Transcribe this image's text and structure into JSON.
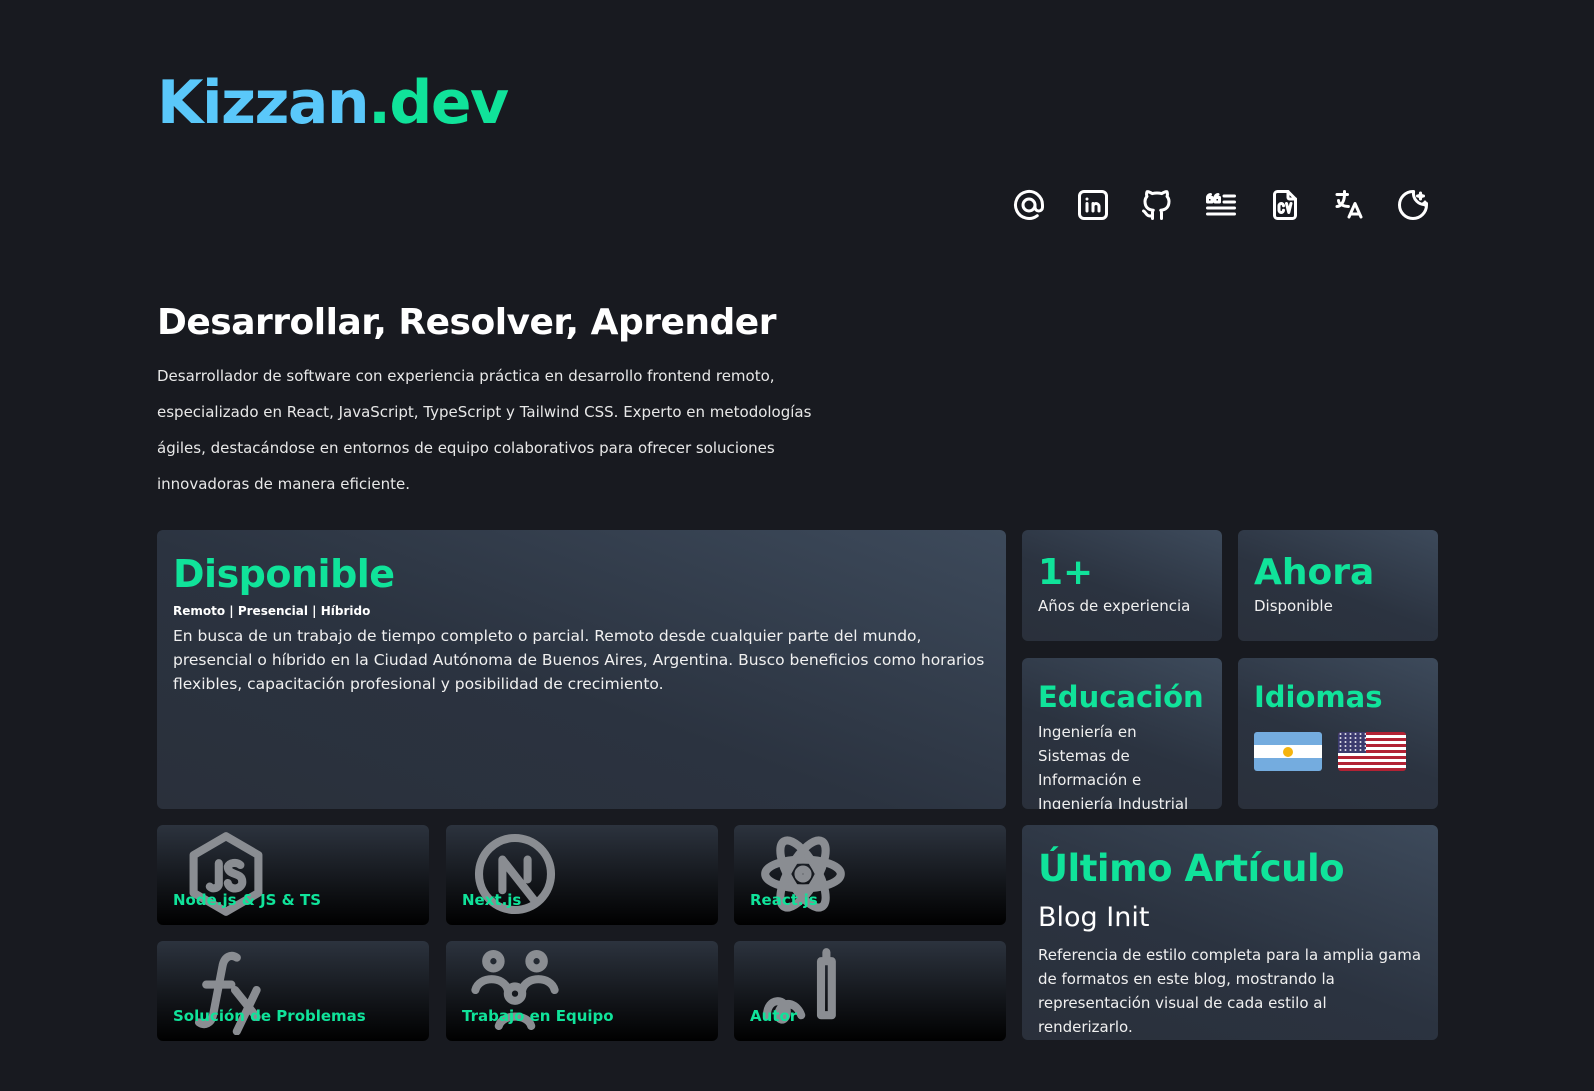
{
  "logo": {
    "part1": "Kizzan",
    "part2": ".dev"
  },
  "nav_icons": [
    "email-icon",
    "linkedin-icon",
    "github-icon",
    "blog-icon",
    "cv-icon",
    "translate-icon",
    "theme-toggle-icon"
  ],
  "hero": {
    "title": "Desarrollar, Resolver, Aprender",
    "description": "Desarrollador de software con experiencia práctica en desarrollo frontend remoto, especializado en React, JavaScript, TypeScript y Tailwind CSS. Experto en metodologías ágiles, destacándose en entornos de equipo colaborativos para ofrecer soluciones innovadoras de manera eficiente."
  },
  "availability": {
    "title": "Disponible",
    "modes": "Remoto | Presencial | Híbrido",
    "text": "En busca de un trabajo de tiempo completo o parcial. Remoto desde cualquier parte del mundo, presencial o híbrido en la Ciudad Autónoma de Buenos Aires, Argentina. Busco beneficios como horarios flexibles, capacitación profesional y posibilidad de crecimiento."
  },
  "experience": {
    "value": "1+",
    "label": "Años de experiencia"
  },
  "now": {
    "value": "Ahora",
    "label": "Disponible"
  },
  "education": {
    "title": "Educación",
    "text": "Ingeniería en Sistemas de Información e Ingeniería Industrial"
  },
  "languages": {
    "title": "Idiomas",
    "flags": [
      "argentina-flag",
      "usa-flag"
    ]
  },
  "skills": [
    {
      "label": "Node.js & JS & TS",
      "icon": "nodejs-icon"
    },
    {
      "label": "Next.js",
      "icon": "nextjs-icon"
    },
    {
      "label": "React.js",
      "icon": "react-icon"
    },
    {
      "label": "Solución de Problemas",
      "icon": "function-icon"
    },
    {
      "label": "Trabajo en Equipo",
      "icon": "team-icon"
    },
    {
      "label": "Autor",
      "icon": "writing-icon"
    }
  ],
  "article": {
    "section_title": "Último Artículo",
    "title": "Blog Init",
    "excerpt": "Referencia de estilo completa para la amplia gama de formatos en este blog, mostrando la representación visual de cada estilo al renderizarlo."
  },
  "colors": {
    "accent": "#10e39a",
    "logo_blue": "#5ac8fa",
    "background": "#181a20"
  }
}
